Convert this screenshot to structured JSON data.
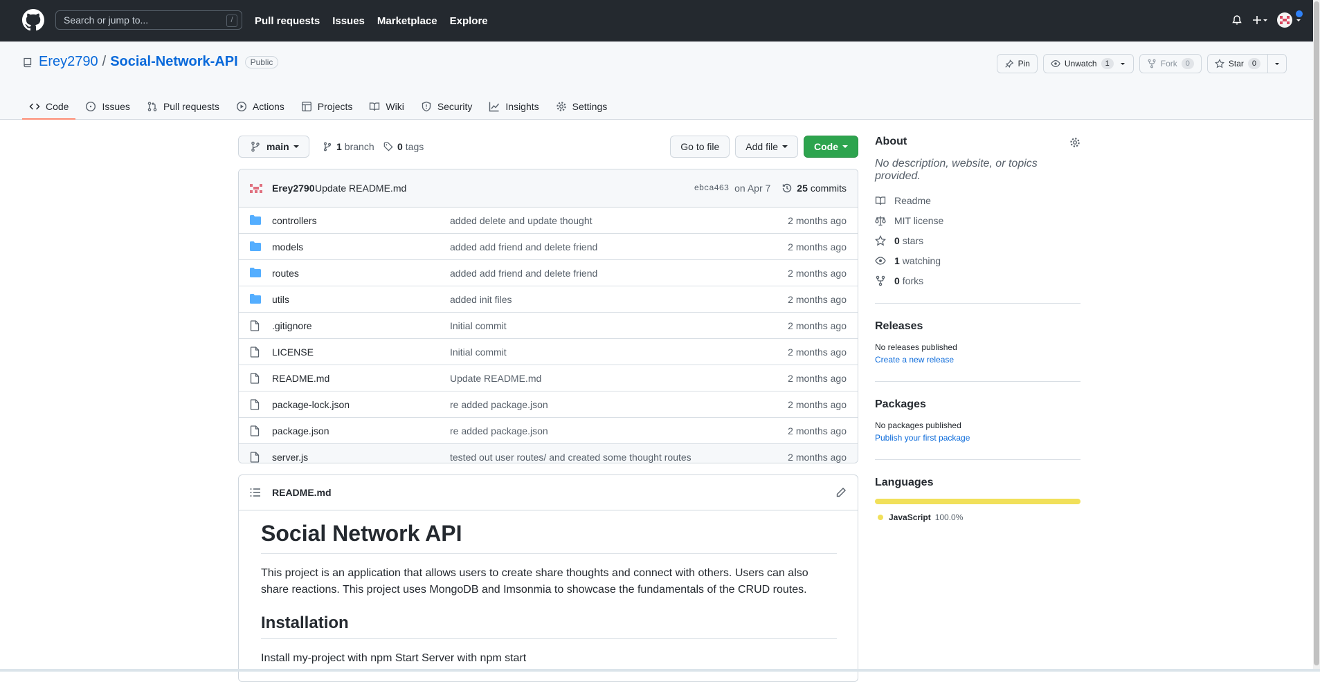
{
  "header": {
    "search_placeholder": "Search or jump to...",
    "search_shortcut": "/",
    "nav": [
      "Pull requests",
      "Issues",
      "Marketplace",
      "Explore"
    ]
  },
  "repo": {
    "owner": "Erey2790",
    "separator": "/",
    "name": "Social-Network-API",
    "visibility": "Public",
    "actions": {
      "pin": "Pin",
      "unwatch": "Unwatch",
      "watch_count": "1",
      "fork": "Fork",
      "fork_count": "0",
      "star": "Star",
      "star_count": "0"
    },
    "tabs": [
      "Code",
      "Issues",
      "Pull requests",
      "Actions",
      "Projects",
      "Wiki",
      "Security",
      "Insights",
      "Settings"
    ],
    "active_tab": "Code"
  },
  "branchbar": {
    "branch": "main",
    "branch_count": "1",
    "branch_label": "branch",
    "tag_count": "0",
    "tag_label": "tags",
    "go_to_file": "Go to file",
    "add_file": "Add file",
    "code": "Code"
  },
  "latest_commit": {
    "author": "Erey2790",
    "message": "Update README.md",
    "sha": "ebca463",
    "date": "on Apr 7",
    "commit_count": "25",
    "commits_label": "commits"
  },
  "files": [
    {
      "type": "dir",
      "name": "controllers",
      "message": "added delete and update thought",
      "age": "2 months ago"
    },
    {
      "type": "dir",
      "name": "models",
      "message": "added add friend and delete friend",
      "age": "2 months ago"
    },
    {
      "type": "dir",
      "name": "routes",
      "message": "added add friend and delete friend",
      "age": "2 months ago"
    },
    {
      "type": "dir",
      "name": "utils",
      "message": "added init files",
      "age": "2 months ago"
    },
    {
      "type": "file",
      "name": ".gitignore",
      "message": "Initial commit",
      "age": "2 months ago"
    },
    {
      "type": "file",
      "name": "LICENSE",
      "message": "Initial commit",
      "age": "2 months ago"
    },
    {
      "type": "file",
      "name": "README.md",
      "message": "Update README.md",
      "age": "2 months ago"
    },
    {
      "type": "file",
      "name": "package-lock.json",
      "message": "re added package.json",
      "age": "2 months ago"
    },
    {
      "type": "file",
      "name": "package.json",
      "message": "re added package.json",
      "age": "2 months ago"
    },
    {
      "type": "file",
      "name": "server.js",
      "message": "tested out user routes/ and created some thought routes",
      "age": "2 months ago"
    }
  ],
  "readme": {
    "filename": "README.md",
    "h1": "Social Network API",
    "intro": "This project is an application that allows users to create share thoughts and connect with others. Users can also share reactions. This project uses MongoDB and Imsonmia to showcase the fundamentals of the CRUD routes.",
    "h2": "Installation",
    "install_text": "Install my-project with npm Start Server with npm start"
  },
  "sidebar": {
    "about_title": "About",
    "about_desc": "No description, website, or topics provided.",
    "readme": "Readme",
    "license": "MIT license",
    "stars_count": "0",
    "stars_label": "stars",
    "watching_count": "1",
    "watching_label": "watching",
    "forks_count": "0",
    "forks_label": "forks",
    "releases_title": "Releases",
    "releases_text": "No releases published",
    "releases_link": "Create a new release",
    "packages_title": "Packages",
    "packages_text": "No packages published",
    "packages_link": "Publish your first package",
    "languages_title": "Languages",
    "language_name": "JavaScript",
    "language_percent": "100.0%",
    "language_color": "#f1e05a"
  }
}
